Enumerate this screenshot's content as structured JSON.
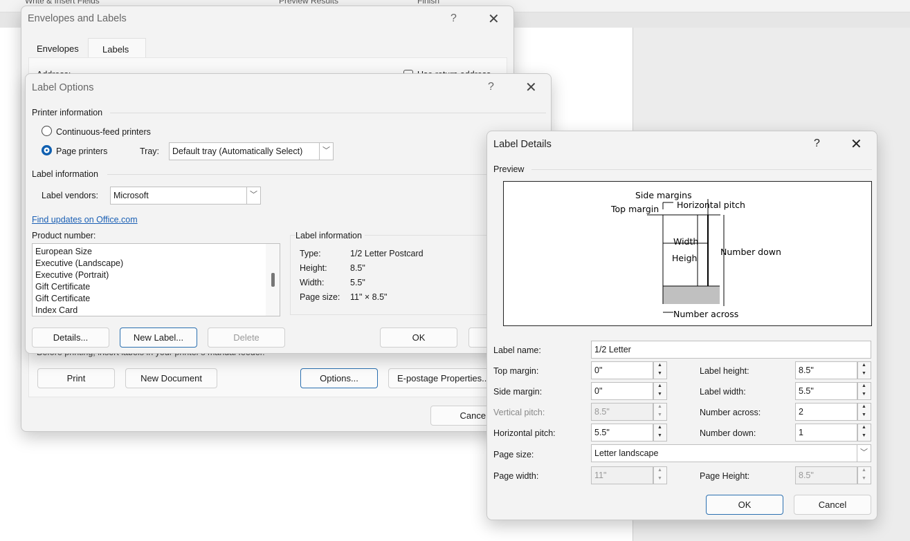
{
  "ribbon": {
    "groups": [
      "Write & Insert Fields",
      "Preview Results",
      "Finish"
    ]
  },
  "env": {
    "title": "Envelopes and Labels",
    "help": "?",
    "close": "✕",
    "tabs": [
      "Envelopes",
      "Labels"
    ],
    "address_label": "Address:",
    "use_return": "Use return address",
    "note": "Before printing, insert labels in your printer's manual feeder.",
    "print": "Print",
    "new_document": "New Document",
    "options": "Options...",
    "epostage": "E-postage Properties...",
    "cancel": "Cancel"
  },
  "opts": {
    "title": "Label Options",
    "help": "?",
    "close": "✕",
    "printer_info": "Printer information",
    "continuous": "Continuous-feed printers",
    "page_printers": "Page printers",
    "selected_printer": "page",
    "tray_label": "Tray:",
    "tray_value": "Default tray (Automatically Select)",
    "label_info": "Label information",
    "vendors_label": "Label vendors:",
    "vendors_value": "Microsoft",
    "find_updates": "Find updates on Office.com",
    "product_label": "Product number:",
    "products": [
      "European Size",
      "Executive (Landscape)",
      "Executive (Portrait)",
      "Gift Certificate",
      "Gift Certificate",
      "Index Card"
    ],
    "info_title": "Label information",
    "info": [
      {
        "k": "Type:",
        "v": "1/2 Letter Postcard"
      },
      {
        "k": "Height:",
        "v": "8.5\""
      },
      {
        "k": "Width:",
        "v": "5.5\""
      },
      {
        "k": "Page size:",
        "v": "11\" × 8.5\""
      }
    ],
    "details": "Details...",
    "new_label": "New Label...",
    "delete": "Delete",
    "ok": "OK"
  },
  "det": {
    "title": "Label Details",
    "help": "?",
    "close": "✕",
    "preview": "Preview",
    "diagram": {
      "side_margins": "Side margins",
      "horizontal_pitch": "Horizontal pitch",
      "top_margin": "Top margin",
      "width": "Width",
      "height": "Heigh",
      "number_down": "Number down",
      "number_across": "Number across"
    },
    "label_name_label": "Label name:",
    "label_name": "1/2 Letter",
    "top_margin_label": "Top margin:",
    "top_margin": "0\"",
    "side_margin_label": "Side margin:",
    "side_margin": "0\"",
    "vertical_pitch_label": "Vertical pitch:",
    "vertical_pitch": "8.5\"",
    "horizontal_pitch_label": "Horizontal pitch:",
    "horizontal_pitch": "5.5\"",
    "label_height_label": "Label height:",
    "label_height": "8.5\"",
    "label_width_label": "Label width:",
    "label_width": "5.5\"",
    "number_across_label": "Number across:",
    "number_across": "2",
    "number_down_label": "Number down:",
    "number_down": "1",
    "page_size_label": "Page size:",
    "page_size": "Letter landscape",
    "page_width_label": "Page width:",
    "page_width": "11\"",
    "page_height_label": "Page Height:",
    "page_height": "8.5\"",
    "ok": "OK",
    "cancel": "Cancel"
  }
}
